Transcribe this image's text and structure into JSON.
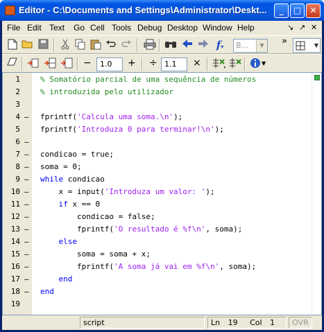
{
  "window": {
    "title": "Editor - C:\\Documents and Settings\\Administrator\\Deskt...",
    "minimize_glyph": "_",
    "maximize_glyph": "□",
    "close_glyph": "✕"
  },
  "menu": {
    "items": [
      "File",
      "Edit",
      "Text",
      "Go",
      "Cell",
      "Tools",
      "Debug",
      "Desktop",
      "Window",
      "Help"
    ],
    "right_glyphs": [
      "↘",
      "↗",
      "✕"
    ]
  },
  "toolbar1": {
    "icons": [
      "new-file-icon",
      "open-folder-icon",
      "save-icon",
      "cut-icon",
      "copy-icon",
      "paste-icon",
      "undo-icon",
      "redo-icon",
      "print-icon",
      "find-icon",
      "back-arrow-icon",
      "forward-arrow-icon",
      "function-icon"
    ],
    "combo_value": "B...",
    "overflow_glyph": "»"
  },
  "toolbar2": {
    "decrement_glyph": "−",
    "value1": "1.0",
    "increment_glyph": "+",
    "divide_glyph": "÷",
    "value2": "1.1",
    "multiply_glyph": "×"
  },
  "editor": {
    "line_numbers": [
      "1",
      "2",
      "3",
      "4",
      "5",
      "6",
      "7",
      "8",
      "9",
      "10",
      "11",
      "12",
      "13",
      "14",
      "15",
      "16",
      "17",
      "18",
      "19"
    ],
    "dashes": [
      "",
      "",
      "",
      "–",
      "",
      "–",
      "–",
      "–",
      "–",
      "–",
      "–",
      "–",
      "–",
      "–",
      "–",
      "–",
      "–",
      "–",
      ""
    ],
    "lines": [
      [
        {
          "t": "cmt",
          "v": "% Somatório parcial de uma sequência de números"
        }
      ],
      [
        {
          "t": "cmt",
          "v": "% introduzida pelo utilizador"
        }
      ],
      [],
      [
        {
          "t": "txt",
          "v": "fprintf("
        },
        {
          "t": "str",
          "v": "'Calcula uma soma.\\n'"
        },
        {
          "t": "txt",
          "v": ");"
        }
      ],
      [
        {
          "t": "txt",
          "v": "fprintf("
        },
        {
          "t": "str",
          "v": "'Introduza 0 para terminar!\\n'"
        },
        {
          "t": "txt",
          "v": ");"
        }
      ],
      [],
      [
        {
          "t": "txt",
          "v": "condicao = true;"
        }
      ],
      [
        {
          "t": "txt",
          "v": "soma = 0;"
        }
      ],
      [
        {
          "t": "kw",
          "v": "while"
        },
        {
          "t": "txt",
          "v": " condicao"
        }
      ],
      [
        {
          "t": "txt",
          "v": "    x = input("
        },
        {
          "t": "str",
          "v": "'Introduza um valor: '"
        },
        {
          "t": "txt",
          "v": ");"
        }
      ],
      [
        {
          "t": "kw",
          "v": "    if"
        },
        {
          "t": "txt",
          "v": " x == 0"
        }
      ],
      [
        {
          "t": "txt",
          "v": "        condicao = false;"
        }
      ],
      [
        {
          "t": "txt",
          "v": "        fprintf("
        },
        {
          "t": "str",
          "v": "'O resultado é %f\\n'"
        },
        {
          "t": "txt",
          "v": ", soma);"
        }
      ],
      [
        {
          "t": "kw",
          "v": "    else"
        }
      ],
      [
        {
          "t": "txt",
          "v": "        soma = soma + x;"
        }
      ],
      [
        {
          "t": "txt",
          "v": "        fprintf("
        },
        {
          "t": "str",
          "v": "'A soma já vai em %f\\n'"
        },
        {
          "t": "txt",
          "v": ", soma);"
        }
      ],
      [
        {
          "t": "kw",
          "v": "    end"
        }
      ],
      [
        {
          "t": "kw",
          "v": "end"
        }
      ],
      []
    ]
  },
  "status": {
    "mode": "script",
    "ln_label": "Ln",
    "ln_value": "19",
    "col_label": "Col",
    "col_value": "1",
    "ovr": "OVR"
  },
  "colors": {
    "comment": "#228B22",
    "string": "#A020F0",
    "keyword": "#0000FF"
  }
}
